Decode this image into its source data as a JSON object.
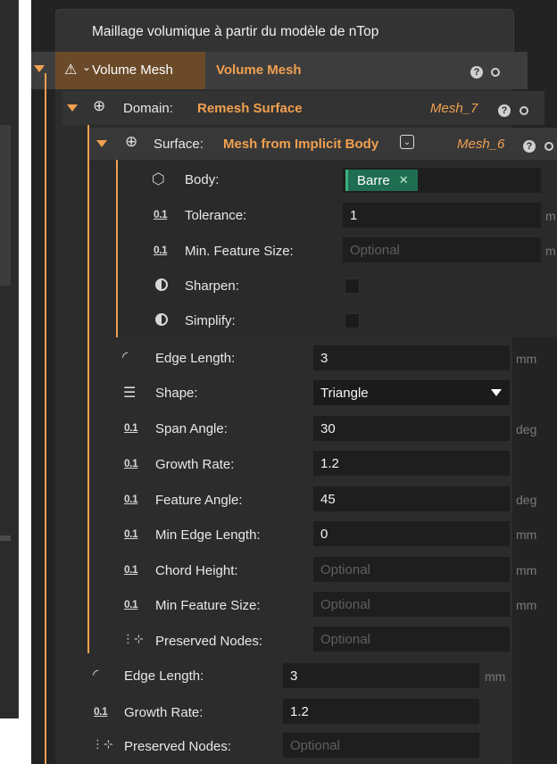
{
  "header": {
    "title": "Maillage volumique à partir du modèle de nTop"
  },
  "volume_mesh": {
    "label": "Volume Mesh",
    "value": "Volume Mesh"
  },
  "domain": {
    "label": "Domain:",
    "value": "Remesh Surface",
    "output": "Mesh_7"
  },
  "surface": {
    "label": "Surface:",
    "value": "Mesh from Implicit Body",
    "output": "Mesh_6"
  },
  "surface_params": {
    "body": {
      "label": "Body:",
      "value": "Barre"
    },
    "tolerance": {
      "label": "Tolerance:",
      "value": "1",
      "unit": "m"
    },
    "min_feature": {
      "label": "Min. Feature Size:",
      "placeholder": "Optional",
      "unit": "m"
    },
    "sharpen": {
      "label": "Sharpen:"
    },
    "simplify": {
      "label": "Simplify:"
    }
  },
  "remesh_params": {
    "edge_length": {
      "label": "Edge Length:",
      "value": "3",
      "unit": "mm"
    },
    "shape": {
      "label": "Shape:",
      "value": "Triangle"
    },
    "span_angle": {
      "label": "Span Angle:",
      "value": "30",
      "unit": "deg"
    },
    "growth_rate": {
      "label": "Growth Rate:",
      "value": "1.2"
    },
    "feature_angle": {
      "label": "Feature Angle:",
      "value": "45",
      "unit": "deg"
    },
    "min_edge_length": {
      "label": "Min Edge Length:",
      "value": "0",
      "unit": "mm"
    },
    "chord_height": {
      "label": "Chord Height:",
      "placeholder": "Optional",
      "unit": "mm"
    },
    "min_feature_size": {
      "label": "Min Feature Size:",
      "placeholder": "Optional",
      "unit": "mm"
    },
    "preserved_nodes": {
      "label": "Preserved Nodes:",
      "placeholder": "Optional"
    }
  },
  "volume_params": {
    "edge_length": {
      "label": "Edge Length:",
      "value": "3",
      "unit": "mm"
    },
    "growth_rate": {
      "label": "Growth Rate:",
      "value": "1.2"
    },
    "preserved_nodes": {
      "label": "Preserved Nodes:",
      "placeholder": "Optional"
    }
  },
  "icons": {
    "help": "?",
    "scalar": "0.1"
  },
  "colors": {
    "accent": "#f0a050",
    "body_tag": "#2a7a5a",
    "bg": "#2c2c2c",
    "field": "#1e1e1e"
  }
}
